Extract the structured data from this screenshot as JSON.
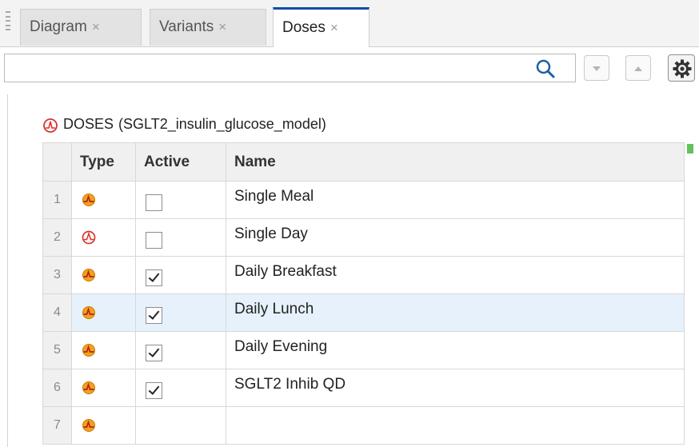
{
  "tabs": [
    {
      "label": "Diagram",
      "close": "×",
      "active": false
    },
    {
      "label": "Variants",
      "close": "×",
      "active": false
    },
    {
      "label": "Doses",
      "close": "×",
      "active": true
    }
  ],
  "search": {
    "value": "",
    "placeholder": ""
  },
  "toolbar_icons": [
    "search-icon",
    "chevron-down-icon",
    "chevron-up-icon",
    "gear-icon"
  ],
  "section": {
    "title": "DOSES",
    "model": "(SGLT2_insulin_glucose_model)",
    "icon": "dose-icon"
  },
  "table": {
    "headers": {
      "type": "Type",
      "active": "Active",
      "name": "Name"
    },
    "rows": [
      {
        "num": "1",
        "type_icon": "repeat-dose-icon",
        "checked": false,
        "name": "Single Meal"
      },
      {
        "num": "2",
        "type_icon": "schedule-dose-icon",
        "checked": false,
        "name": "Single Day"
      },
      {
        "num": "3",
        "type_icon": "repeat-dose-icon",
        "checked": true,
        "name": "Daily Breakfast"
      },
      {
        "num": "4",
        "type_icon": "repeat-dose-icon",
        "checked": true,
        "name": "Daily Lunch"
      },
      {
        "num": "5",
        "type_icon": "repeat-dose-icon",
        "checked": true,
        "name": "Daily Evening"
      },
      {
        "num": "6",
        "type_icon": "repeat-dose-icon",
        "checked": true,
        "name": "SGLT2 Inhib QD"
      },
      {
        "num": "7",
        "type_icon": "repeat-dose-icon",
        "checked": null,
        "name": ""
      }
    ],
    "selected_row": 4
  },
  "colors": {
    "active_tab_accent": "#0b4fa3",
    "dose_icon_red": "#d9342b",
    "repeat_dose_orange": "#f2a21b",
    "selected_row_bg": "#e6f1fb",
    "status_marker_green": "#63c15c"
  }
}
